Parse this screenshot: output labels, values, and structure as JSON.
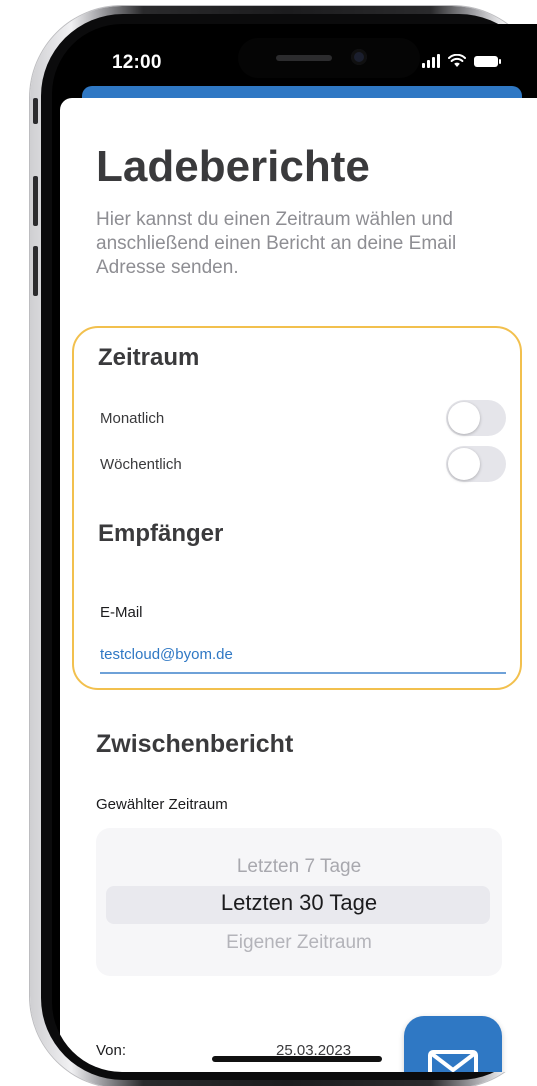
{
  "status_bar": {
    "time": "12:00",
    "signal_icon": "cellular-signal-icon",
    "wifi_icon": "wifi-icon",
    "battery_icon": "battery-icon"
  },
  "header": {
    "title": "Ladeberichte",
    "subtitle": "Hier kannst du einen Zeitraum wählen und anschließend einen Bericht an deine Email Adresse senden."
  },
  "period_section": {
    "title": "Zeitraum",
    "options": [
      {
        "label": "Monatlich",
        "enabled": false
      },
      {
        "label": "Wöchentlich",
        "enabled": false
      }
    ]
  },
  "recipient_section": {
    "title": "Empfänger",
    "email_label": "E-Mail",
    "email_value": "testcloud@byom.de"
  },
  "interim_report": {
    "title": "Zwischenbericht",
    "selected_period_label": "Gewählter Zeitraum",
    "picker_options": [
      "Letzten 7 Tage",
      "Letzten 30 Tage",
      "Eigener Zeitraum"
    ],
    "selected_index": 1,
    "from_label": "Von:",
    "from_value": "25.03.2023"
  },
  "send_button": {
    "icon": "mail-icon"
  },
  "colors": {
    "accent": "#2f78c4",
    "highlight_border": "#f2c04e",
    "title_text": "#3a3a3c",
    "secondary_text": "#8e8e93"
  }
}
